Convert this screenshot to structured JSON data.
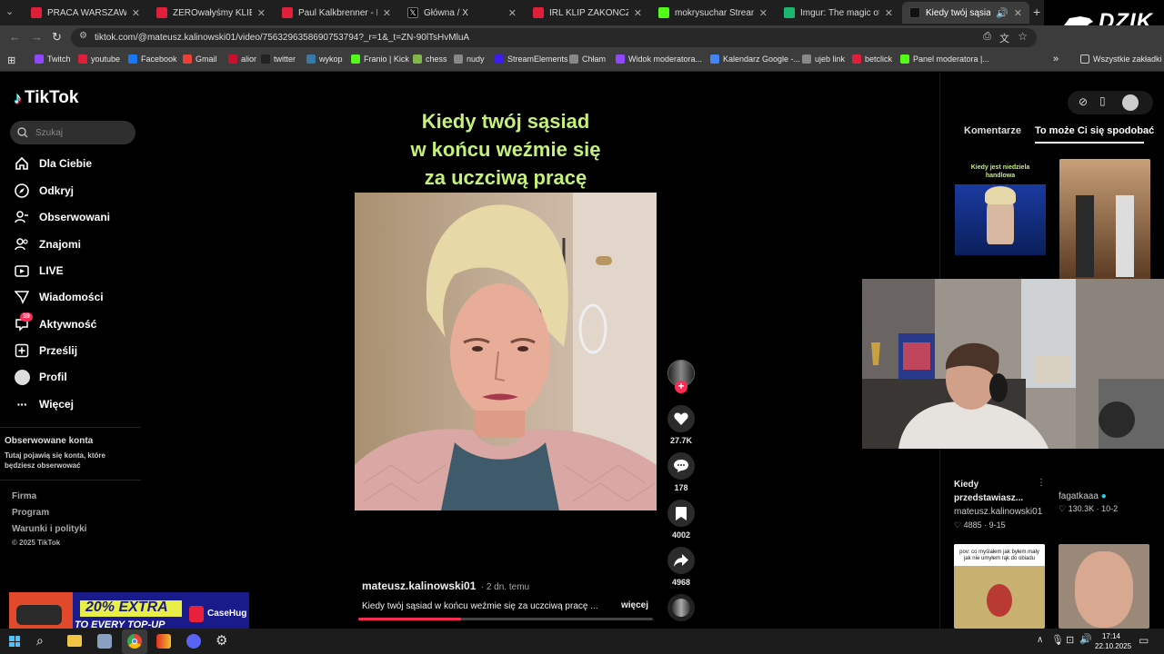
{
  "browser": {
    "tabs": [
      {
        "label": "PRACA WARSZAWSKIEJ E",
        "color": "#e0203a"
      },
      {
        "label": "ZEROwałyśmy KLIENTOM",
        "color": "#e0203a"
      },
      {
        "label": "Paul Kalkbrenner - Live at",
        "color": "#e0203a"
      },
      {
        "label": "Główna / X",
        "color": "#000000"
      },
      {
        "label": "IRL KLIP ZAKOŃCZONY I",
        "color": "#e0203a"
      },
      {
        "label": "mokrysuchar Stream - Wa",
        "color": "#53fc18"
      },
      {
        "label": "Imgur: The magic of the I",
        "color": "#1bb76e"
      },
      {
        "label": "Kiedy twój sąsiad po",
        "color": "#111111"
      }
    ],
    "new_tab": "+",
    "url": "tiktok.com/@mateusz.kalinowski01/video/7563296358690753794?_r=1&_t=ZN-90lTsHvMluA",
    "bookmarks": [
      {
        "label": "Twitch",
        "color": "#9146ff"
      },
      {
        "label": "youtube",
        "color": "#e0203a"
      },
      {
        "label": "Facebook",
        "color": "#1877f2"
      },
      {
        "label": "Gmail",
        "color": "#ea4335"
      },
      {
        "label": "alior",
        "color": "#c8102e"
      },
      {
        "label": "twitter",
        "color": "#222222"
      },
      {
        "label": "wykop",
        "color": "#367aa9"
      },
      {
        "label": "Franio | Kick",
        "color": "#53fc18"
      },
      {
        "label": "chess",
        "color": "#81b64c"
      },
      {
        "label": "nudy",
        "color": "#888888"
      },
      {
        "label": "StreamElements",
        "color": "#3b1df0"
      },
      {
        "label": "Chłam",
        "color": "#888888"
      },
      {
        "label": "Widok moderatora...",
        "color": "#9146ff"
      },
      {
        "label": "Kalendarz Google -...",
        "color": "#4285f4"
      },
      {
        "label": "ujeb link",
        "color": "#888888"
      },
      {
        "label": "betclick",
        "color": "#e0203a"
      },
      {
        "label": "Panel moderatora |...",
        "color": "#53fc18"
      }
    ],
    "all_bookmarks": "Wszystkie zakładki"
  },
  "overlay_logo": "DZIK",
  "tiktok": {
    "logo": "TikTok",
    "search_placeholder": "Szukaj",
    "nav": [
      {
        "label": "Dla Ciebie",
        "icon": "home-icon"
      },
      {
        "label": "Odkryj",
        "icon": "compass-icon"
      },
      {
        "label": "Obserwowani",
        "icon": "following-icon"
      },
      {
        "label": "Znajomi",
        "icon": "friends-icon"
      },
      {
        "label": "LIVE",
        "icon": "live-icon"
      },
      {
        "label": "Wiadomości",
        "icon": "messages-icon"
      },
      {
        "label": "Aktywność",
        "icon": "activity-icon"
      },
      {
        "label": "Prześlij",
        "icon": "upload-icon"
      },
      {
        "label": "Profil",
        "icon": "profile-icon"
      },
      {
        "label": "Więcej",
        "icon": "more-icon"
      }
    ],
    "activity_badge": "39",
    "followed_title": "Obserwowane konta",
    "followed_desc": "Tutaj pojawią się konta, które będziesz obserwować",
    "footer": [
      "Firma",
      "Program",
      "Warunki i polityki"
    ],
    "copyright": "© 2025 TikTok"
  },
  "video": {
    "caption_lines": [
      "Kiedy twój sąsiad",
      "w końcu weźmie się",
      "za uczciwą pracę"
    ],
    "author": "mateusz.kalinowski01",
    "posted": "· 2 dn. temu",
    "description": "Kiedy twój sąsiad w końcu weźmie się za uczciwą pracę ...",
    "more": "więcej",
    "progress": 0.35,
    "likes": "27.7K",
    "comments": "178",
    "saves": "4002",
    "shares": "4968"
  },
  "right_panel": {
    "tabs": [
      "Komentarze",
      "To może Ci się spodobać"
    ],
    "cards": [
      {
        "thumb_text": "Kiedy jest niedziela handlowa",
        "title": "Kiedy przedstawiasz...",
        "author": "mateusz.kalinowski01",
        "likes": "4885",
        "date": "9-15"
      },
      {
        "thumb_text": "",
        "title": "",
        "author": "fagatkaaa",
        "likes": "130.3K",
        "date": "10-2"
      },
      {
        "thumb_text": "pov: co myślałem jak byłem mały jak nie umyłem rąk do obiadu",
        "title": "",
        "author": "",
        "likes": "",
        "date": ""
      }
    ]
  },
  "ad": {
    "headline": "20% EXTRA",
    "sub": "TO EVERY TOP-UP",
    "brand": "CaseHug"
  },
  "taskbar": {
    "time": "17:14",
    "date": "22.10.2025",
    "colors": {
      "chrome_active": "#3a3a3a"
    }
  }
}
